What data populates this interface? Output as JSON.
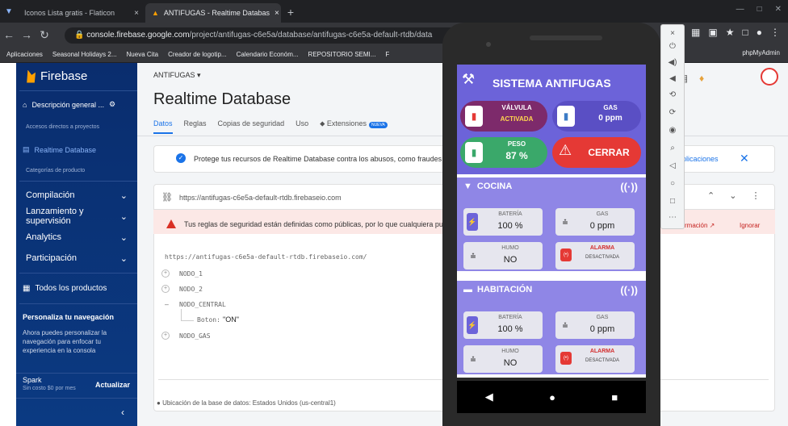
{
  "browser": {
    "tabs": [
      {
        "label": "Iconos Lista gratis - Flaticon",
        "close": "×"
      },
      {
        "label": "ANTIFUGAS - Realtime Databas",
        "close": "×"
      }
    ],
    "new_tab": "+",
    "url_prefix": "console.firebase.google.com",
    "url_rest": "/project/antifugas-c6e5a/database/antifugas-c6e5a-default-rtdb/data",
    "bookmarks": [
      "Aplicaciones",
      "Seasonal Holidays 2...",
      "Nueva Cita",
      "Creador de logotip...",
      "Calendario Económ...",
      "REPOSITORIO SEMI...",
      "F"
    ],
    "bookmark_right": "phpMyAdmin"
  },
  "sidebar": {
    "brand": "Firebase",
    "overview": "Descripción general ...",
    "shortcuts_label": "Accesos directos a proyectos",
    "active_item": "Realtime Database",
    "category_label": "Categorías de producto",
    "groups": [
      "Compilación",
      "Lanzamiento y supervisión",
      "Analytics",
      "Participación"
    ],
    "all_products": "Todos los productos",
    "promo_title": "Personaliza tu navegación",
    "promo_text": "Ahora puedes personalizar la navegación para enfocar tu experiencia en la consola",
    "plan_name": "Spark",
    "plan_desc": "Sin costo $0 por mes",
    "upgrade": "Actualizar",
    "collapse": "‹"
  },
  "main": {
    "project": "ANTIFUGAS ▾",
    "title": "Realtime Database",
    "tabs": [
      "Datos",
      "Reglas",
      "Copias de seguridad",
      "Uso",
      "Extensiones"
    ],
    "tab_badge": "NUEVA",
    "notice": "Protege tus recursos de Realtime Database contra los abusos, como fraudes de",
    "notice_link": "plicaciones",
    "db_url": "https://antifugas-c6e5a-default-rtdb.firebaseio.com",
    "warning": "Tus reglas de seguridad están definidas como públicas, por lo que cualquiera pued",
    "warning_more": "rmación",
    "warning_ignore": "Ignorar",
    "tree_root": "https://antifugas-c6e5a-default-rtdb.firebaseio.com/",
    "nodes": [
      "NODO_1",
      "NODO_2",
      "NODO_CENTRAL",
      "NODO_GAS"
    ],
    "child_key": "Boton:",
    "child_value": "\"ON\"",
    "location": "Ubicación de la base de datos: Estados Unidos (us-central1)"
  },
  "app": {
    "title": "SISTEMA ANTIFUGAS",
    "valve_label": "VÁLVULA",
    "valve_state": "ACTIVADA",
    "gas_label": "GAS",
    "gas_value": "0 ppm",
    "weight_label": "PESO",
    "weight_value": "87 %",
    "close_button": "CERRAR",
    "rooms": [
      {
        "name": "COCINA",
        "battery_label": "BATERÍA",
        "battery_value": "100 %",
        "gas_label": "GAS",
        "gas_value": "0 ppm",
        "smoke_label": "HUMO",
        "smoke_value": "NO",
        "alarm_label": "ALARMA",
        "alarm_value": "DESACTIVADA"
      },
      {
        "name": "HABITACIÓN",
        "battery_label": "BATERÍA",
        "battery_value": "100 %",
        "gas_label": "GAS",
        "gas_value": "0 ppm",
        "smoke_label": "HUMO",
        "smoke_value": "NO",
        "alarm_label": "ALARMA",
        "alarm_value": "DESACTIVADA"
      }
    ],
    "nav": [
      "◀",
      "●",
      "■"
    ]
  },
  "colors": {
    "accent": "#6c63d9",
    "danger": "#e53935",
    "firebase_blue": "#0b3a82"
  }
}
